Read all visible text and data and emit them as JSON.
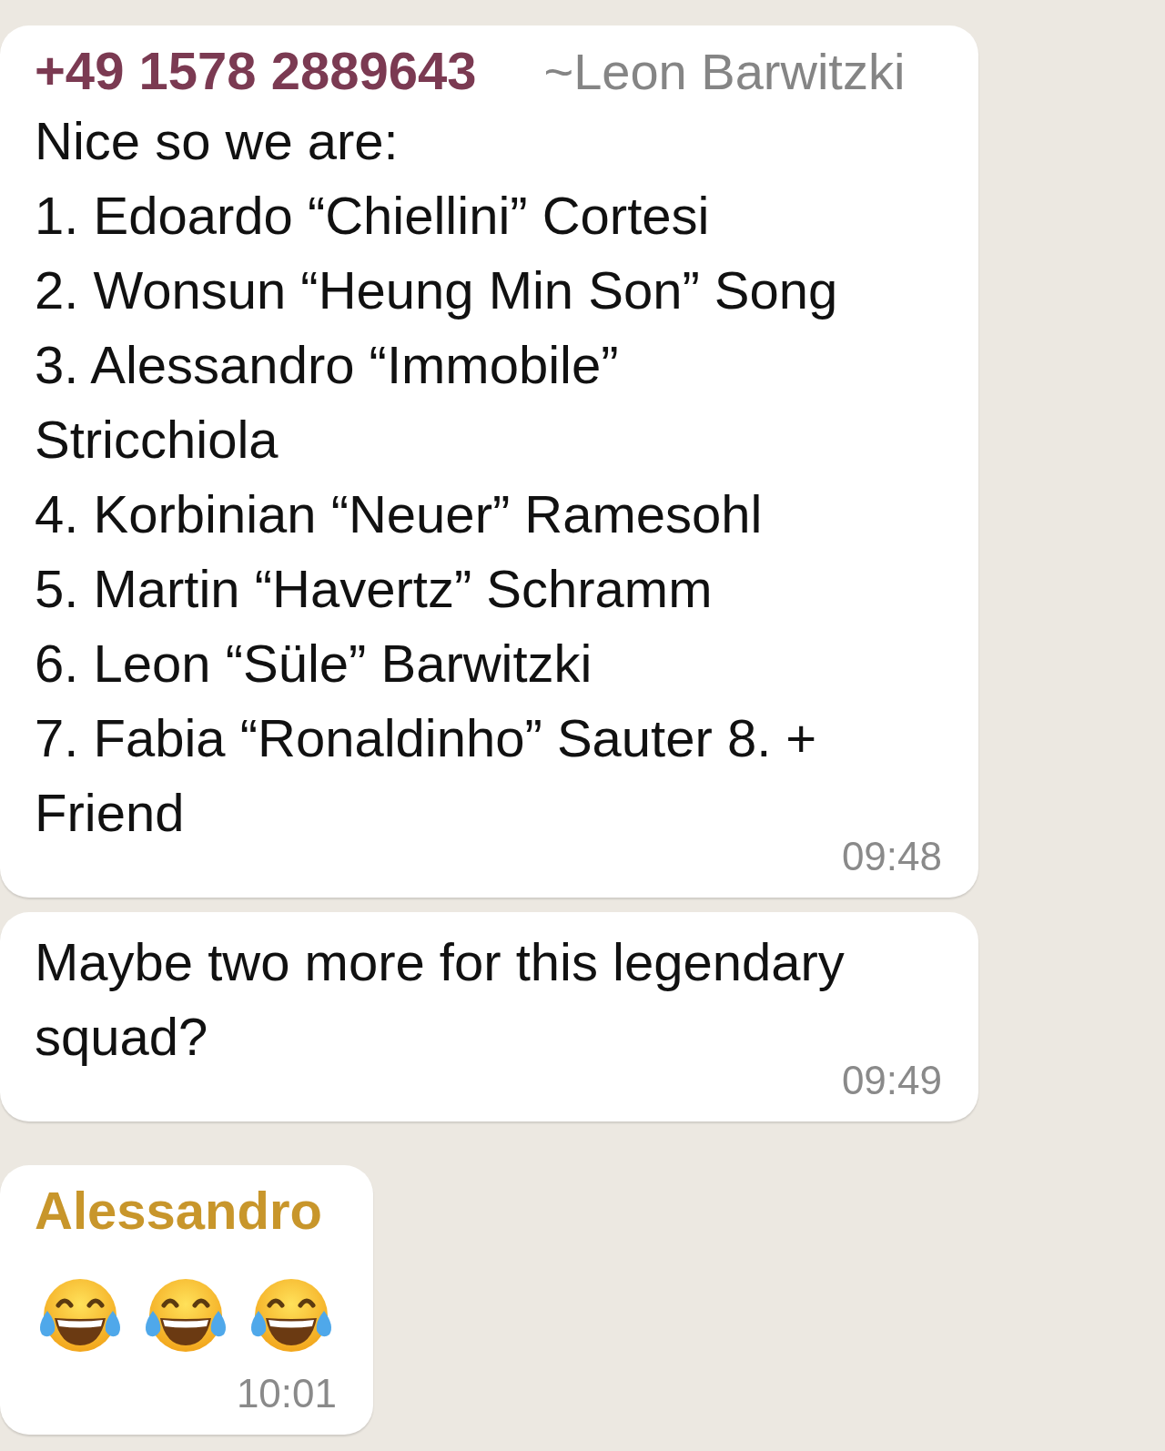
{
  "messages": [
    {
      "sender": "+49 1578 2889643",
      "color": "#7b3a52",
      "push_name": "~Leon Barwitzki",
      "lines": [
        "Nice so we are:",
        "1. Edoardo “Chiellini” Cortesi",
        "2. Wonsun “Heung Min Son” Song",
        "3. Alessandro “Immobile”",
        "Stricchiola",
        "4. Korbinian “Neuer” Ramesohl",
        "5. Martin “Havertz” Schramm",
        "6. Leon “Süle” Barwitzki",
        "7. Fabia “Ronaldinho” Sauter 8. +",
        "Friend"
      ],
      "time": "09:48"
    },
    {
      "lines": [
        "Maybe two more for this legendary",
        "squad?"
      ],
      "time": "09:49"
    },
    {
      "sender": "Alessandro",
      "color": "#c8962b",
      "emojis": [
        {
          "kind": "tears-of-joy"
        },
        {
          "kind": "tears-of-joy"
        },
        {
          "kind": "tears-of-joy"
        }
      ],
      "time": "10:01"
    }
  ]
}
